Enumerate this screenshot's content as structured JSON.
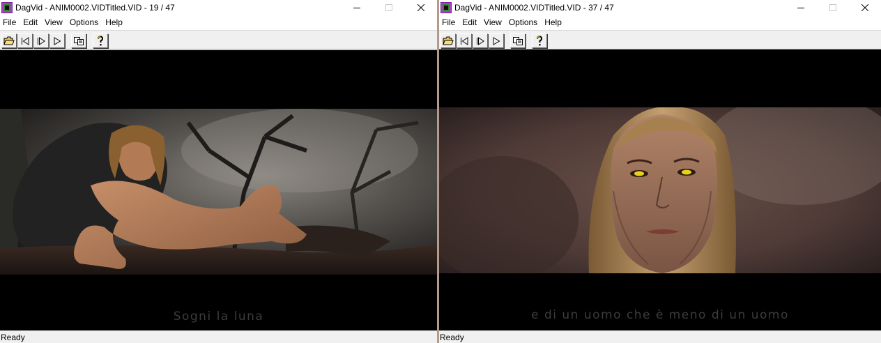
{
  "windows": [
    {
      "title": "DagVid - ANIM0002.VIDTitled.VID - 19 / 47",
      "menu": [
        "File",
        "Edit",
        "View",
        "Options",
        "Help"
      ],
      "subtitle": "Sogni la luna",
      "status": "Ready"
    },
    {
      "title": "DagVid - ANIM0002.VIDTitled.VID - 37 / 47",
      "menu": [
        "File",
        "Edit",
        "View",
        "Options",
        "Help"
      ],
      "subtitle": "e di un uomo che è meno di un uomo",
      "status": "Ready"
    }
  ],
  "toolbar_icons": [
    "open-folder-icon",
    "previous-frame-icon",
    "next-frame-icon",
    "play-icon",
    "copy-icon",
    "help-icon"
  ],
  "colors": {
    "title_bar": "#ffffff",
    "chrome": "#f0f0f0",
    "video_background": "#000000",
    "subtitle_text": "#3c3c3c",
    "window_divider": "#b49a8a"
  }
}
